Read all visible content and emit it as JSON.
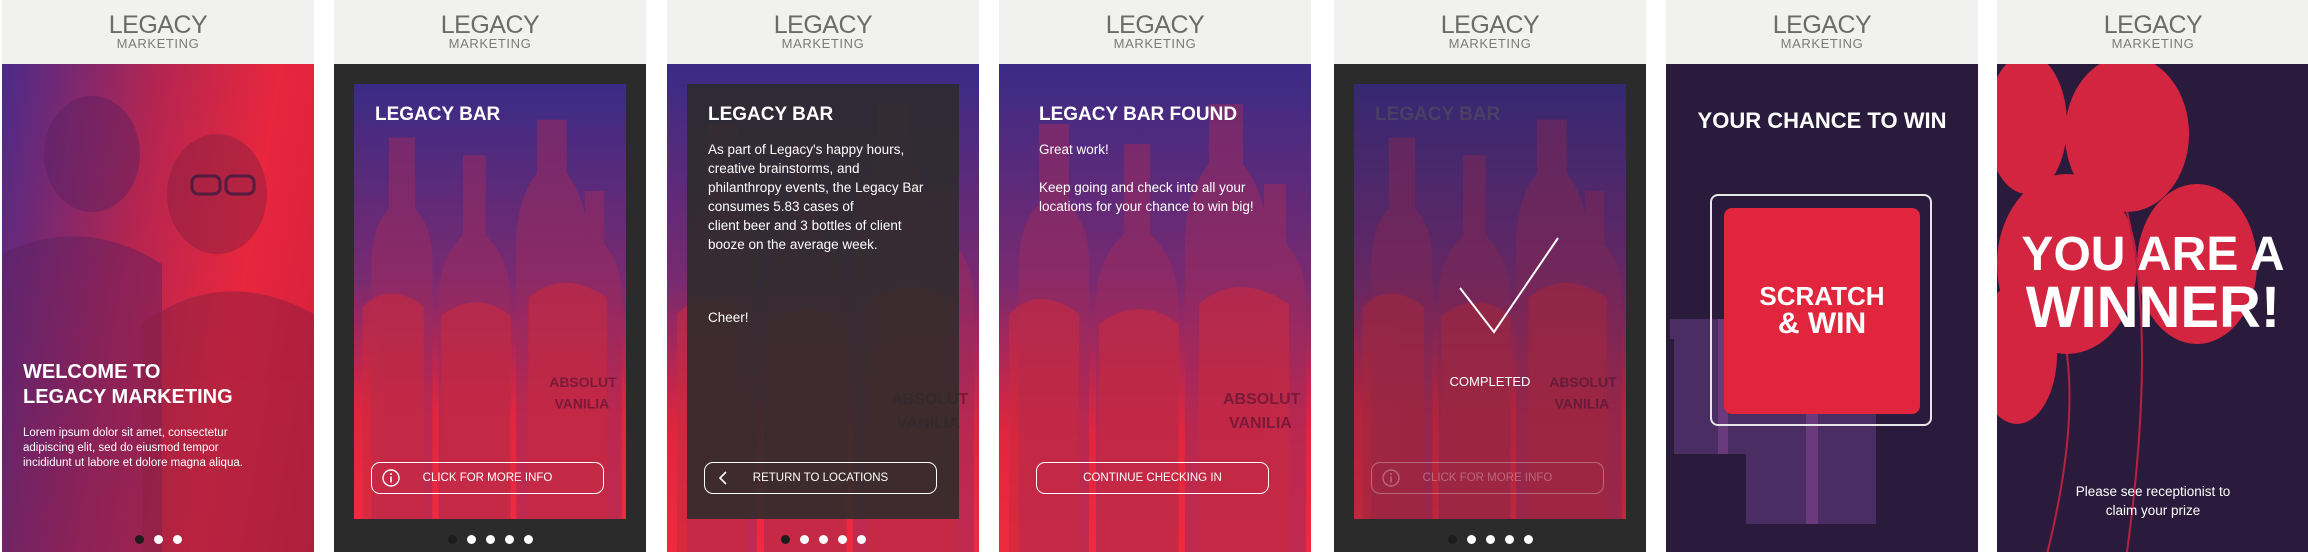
{
  "brand": {
    "logo_top": "LEGACY",
    "logo_sub": "MARKETING"
  },
  "colors": {
    "accent": "#e1253c",
    "deep_purple": "#2a1b3c",
    "header_bg": "#f1f1ef"
  },
  "screen1": {
    "title": "WELCOME TO\nLEGACY MARKETING",
    "body": "Lorem ipsum dolor sit amet, consectetur adipiscing elit, sed do eiusmod tempor incididunt ut labore et dolore magna aliqua."
  },
  "screen2": {
    "title": "LEGACY BAR",
    "button_label": "CLICK FOR MORE INFO",
    "button_icon": "info-icon"
  },
  "screen3": {
    "title": "LEGACY BAR",
    "body": "As part of Legacy's happy hours,\ncreative brainstorms, and\nphilanthropy events, the Legacy Bar\nconsumes 5.83 cases of\nclient beer and 3 bottles of client\nbooze on the average week.",
    "cheer": "Cheer!",
    "button_label": "RETURN TO LOCATIONS",
    "button_icon": "chevron-left-icon"
  },
  "screen4": {
    "title": "LEGACY BAR FOUND",
    "line1": "Great work!",
    "line2": "Keep going and check into all your\nlocations for your chance to win big!",
    "button_label": "CONTINUE CHECKING IN"
  },
  "screen5": {
    "title": "LEGACY BAR",
    "status": "COMPLETED",
    "button_label": "CLICK FOR MORE INFO"
  },
  "screen6": {
    "title": "YOUR CHANCE TO WIN",
    "scratch_top": "SCRATCH",
    "scratch_bottom": "& WIN"
  },
  "screen7": {
    "title_line1": "YOU ARE A",
    "title_line2": "WINNER!",
    "note": "Please see receptionist to\nclaim your prize"
  },
  "pagination": {
    "s1_total": 3,
    "s1_active": 1,
    "others_total": 5,
    "s2_active": 1,
    "s3_active": 1,
    "s5_active": 1
  }
}
